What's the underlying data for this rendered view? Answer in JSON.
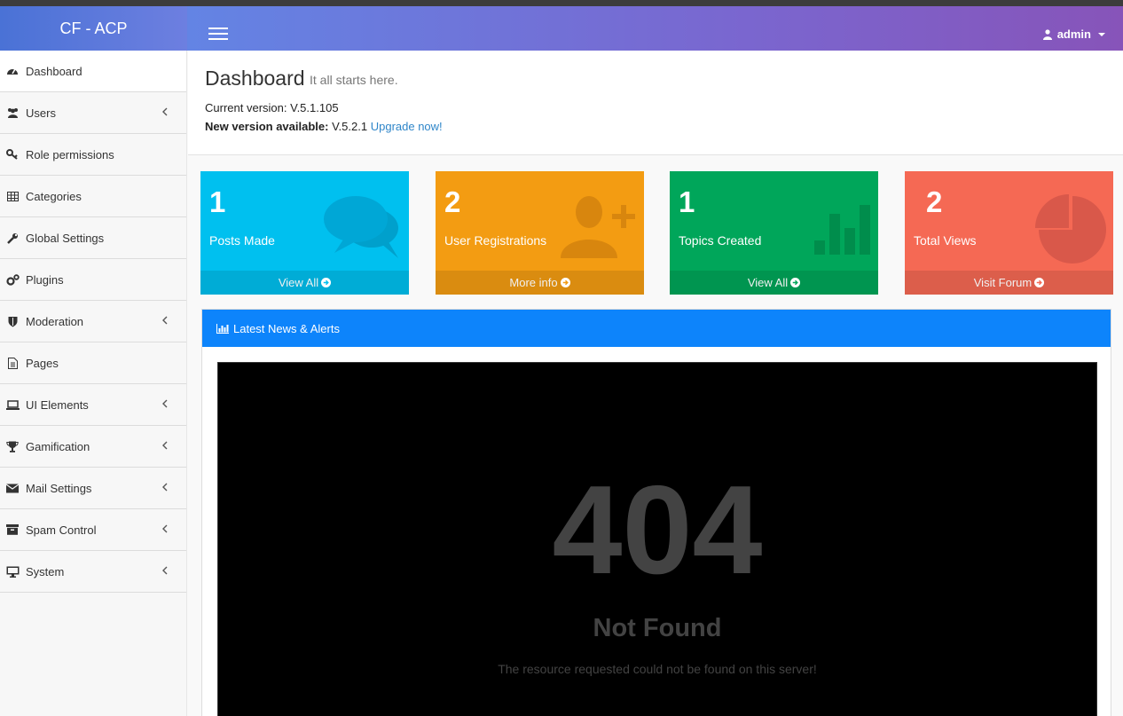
{
  "brand": "CF - ACP",
  "user": {
    "name": "admin"
  },
  "sidebar": {
    "items": [
      {
        "label": "Dashboard",
        "icon": "dashboard-icon"
      },
      {
        "label": "Users",
        "icon": "users-icon"
      },
      {
        "label": "Role permissions",
        "icon": "key-icon"
      },
      {
        "label": "Categories",
        "icon": "table-icon"
      },
      {
        "label": "Global Settings",
        "icon": "wrench-icon"
      },
      {
        "label": "Plugins",
        "icon": "cogs-icon"
      },
      {
        "label": "Moderation",
        "icon": "shield-icon"
      },
      {
        "label": "Pages",
        "icon": "file-icon"
      },
      {
        "label": "UI Elements",
        "icon": "laptop-icon"
      },
      {
        "label": "Gamification",
        "icon": "trophy-icon"
      },
      {
        "label": "Mail Settings",
        "icon": "envelope-icon"
      },
      {
        "label": "Spam Control",
        "icon": "archive-icon"
      },
      {
        "label": "System",
        "icon": "desktop-icon"
      }
    ]
  },
  "header": {
    "title": "Dashboard",
    "subtitle": "It all starts here.",
    "current_version_label": "Current version: V.5.1.105",
    "new_version_label": "New version available:",
    "new_version_value": "V.5.2.1",
    "upgrade_link": "Upgrade now!"
  },
  "stats": [
    {
      "value": "1",
      "label": "Posts Made",
      "link": "View All",
      "color": "#00c0ef",
      "icon": "comments-icon"
    },
    {
      "value": "2",
      "label": "User Registrations",
      "link": "More info",
      "color": "#f39c12",
      "icon": "user-plus-icon"
    },
    {
      "value": "1",
      "label": "Topics Created",
      "link": "View All",
      "color": "#00a65a",
      "icon": "bar-chart-icon"
    },
    {
      "value": "2",
      "label": "Total Views",
      "link": "Visit Forum",
      "color": "#f56954",
      "icon": "pie-chart-icon"
    }
  ],
  "news": {
    "title": "Latest News & Alerts",
    "error_code": "404",
    "error_title": "Not Found",
    "error_message": "The resource requested could not be found on this server!"
  }
}
